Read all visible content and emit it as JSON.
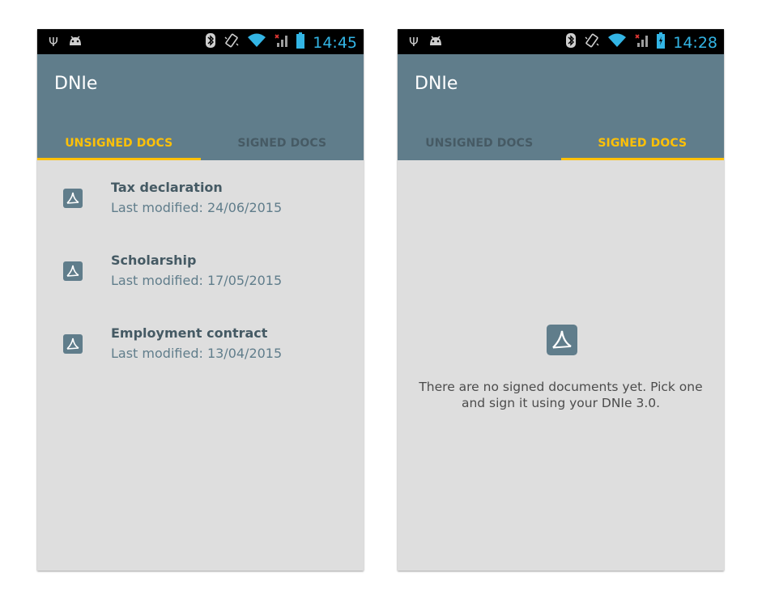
{
  "screens": [
    {
      "status_bar": {
        "time": "14:45",
        "left_icons": [
          "usb-icon",
          "android-debug-icon"
        ],
        "right_icons": [
          "bluetooth-icon",
          "vibrate-icon",
          "wifi-icon",
          "signal-icon",
          "battery-icon"
        ]
      },
      "app_bar": {
        "title": "DNIe"
      },
      "tabs": [
        {
          "label": "UNSIGNED DOCS",
          "active": true
        },
        {
          "label": "SIGNED DOCS",
          "active": false
        }
      ],
      "documents": [
        {
          "title": "Tax declaration",
          "subtitle": "Last modified: 24/06/2015",
          "icon": "pdf-icon"
        },
        {
          "title": "Scholarship",
          "subtitle": "Last modified: 17/05/2015",
          "icon": "pdf-icon"
        },
        {
          "title": "Employment contract",
          "subtitle": "Last modified: 13/04/2015",
          "icon": "pdf-icon"
        }
      ]
    },
    {
      "status_bar": {
        "time": "14:28",
        "left_icons": [
          "usb-icon",
          "android-debug-icon"
        ],
        "right_icons": [
          "bluetooth-icon",
          "vibrate-icon",
          "wifi-icon",
          "signal-icon",
          "battery-charging-icon"
        ]
      },
      "app_bar": {
        "title": "DNIe"
      },
      "tabs": [
        {
          "label": "UNSIGNED DOCS",
          "active": false
        },
        {
          "label": "SIGNED DOCS",
          "active": true
        }
      ],
      "empty_state": {
        "icon": "pdf-icon",
        "message": "There are no signed documents yet. Pick one and sign it using your DNIe 3.0."
      }
    }
  ],
  "colors": {
    "app_bar": "#607d8b",
    "accent": "#ffc107",
    "background": "#dedede",
    "status_time": "#33b5e5",
    "doc_title": "#455a64",
    "doc_subtitle": "#607d8b"
  }
}
